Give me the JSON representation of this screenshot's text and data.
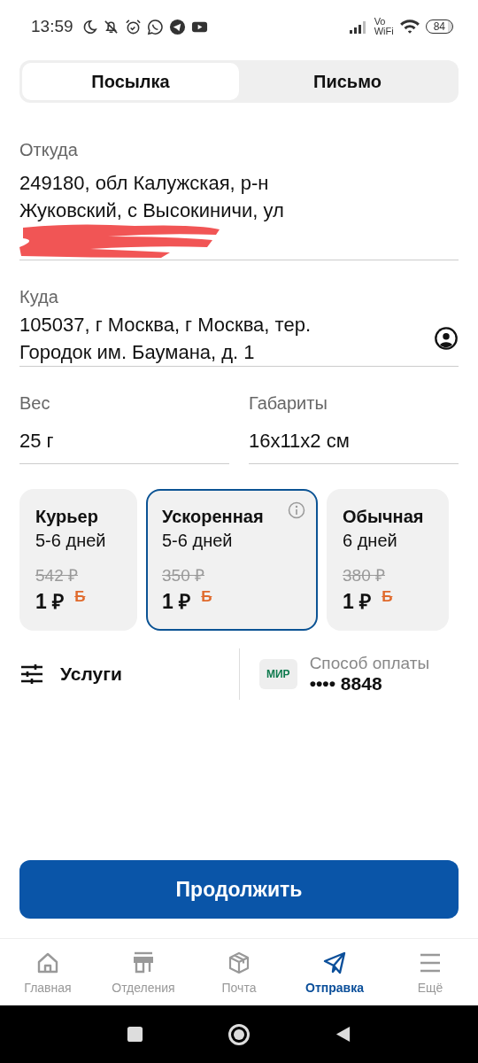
{
  "status_bar": {
    "time": "13:59",
    "network_label_top": "Vo",
    "network_label_bottom": "WiFi",
    "battery": "84"
  },
  "tabs": [
    {
      "label": "Посылка",
      "selected": true
    },
    {
      "label": "Письмо",
      "selected": false
    }
  ],
  "from": {
    "label": "Откуда",
    "lines": [
      "249180, обл Калужская, р-н",
      "Жуковский, с Высокиничи, ул"
    ],
    "redacted": true
  },
  "to": {
    "label": "Куда",
    "lines": [
      "105037, г Москва, г Москва, тер.",
      "Городок им. Баумана, д. 1"
    ]
  },
  "weight": {
    "label": "Вес",
    "value": "25 г"
  },
  "dimensions": {
    "label": "Габариты",
    "value": "16x11x2 см"
  },
  "tariffs": [
    {
      "name": "Курьер",
      "term": "5-6 дней",
      "old_price": "542 ₽",
      "price": "1 ₽",
      "bonus": "Б",
      "selected": false,
      "info": false
    },
    {
      "name": "Ускоренная",
      "term": "5-6 дней",
      "old_price": "350 ₽",
      "price": "1 ₽",
      "bonus": "Б",
      "selected": true,
      "info": true
    },
    {
      "name": "Обычная",
      "term": "6 дней",
      "old_price": "380 ₽",
      "price": "1 ₽",
      "bonus": "Б",
      "selected": false,
      "info": false
    }
  ],
  "services": {
    "label": "Услуги"
  },
  "payment": {
    "label": "Способ оплаты",
    "card_logo": "МИР",
    "card": "•••• 8848"
  },
  "continue_button": "Продолжить",
  "nav": [
    {
      "label": "Главная",
      "kind": "home",
      "selected": false
    },
    {
      "label": "Отделения",
      "kind": "office",
      "selected": false
    },
    {
      "label": "Почта",
      "kind": "box",
      "selected": false
    },
    {
      "label": "Отправка",
      "kind": "send",
      "selected": true
    },
    {
      "label": "Ещё",
      "kind": "menu",
      "selected": false
    }
  ]
}
